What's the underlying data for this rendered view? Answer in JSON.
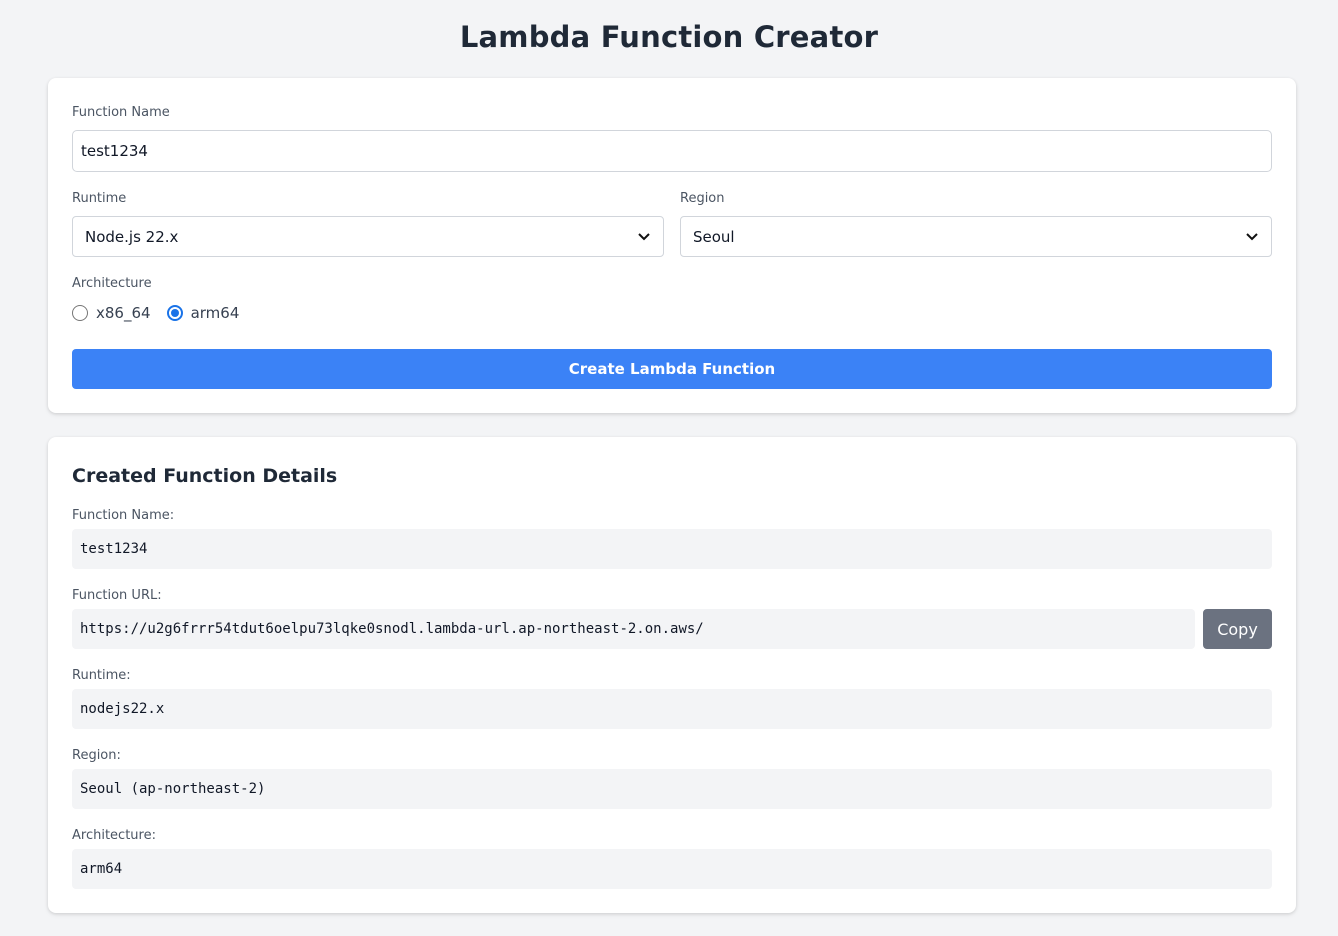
{
  "header": {
    "title": "Lambda Function Creator"
  },
  "form": {
    "function_name_label": "Function Name",
    "function_name_value": "test1234",
    "runtime_label": "Runtime",
    "runtime_selected": "Node.js 22.x",
    "region_label": "Region",
    "region_selected": "Seoul",
    "architecture_label": "Architecture",
    "architecture_options": [
      {
        "label": "x86_64",
        "checked": false
      },
      {
        "label": "arm64",
        "checked": true
      }
    ],
    "submit_label": "Create Lambda Function"
  },
  "details": {
    "title": "Created Function Details",
    "function_name_label": "Function Name:",
    "function_name_value": "test1234",
    "function_url_label": "Function URL:",
    "function_url_value": "https://u2g6frrr54tdut6oelpu73lqke0snodl.lambda-url.ap-northeast-2.on.aws/",
    "copy_label": "Copy",
    "runtime_label": "Runtime:",
    "runtime_value": "nodejs22.x",
    "region_label": "Region:",
    "region_value": "Seoul (ap-northeast-2)",
    "architecture_label": "Architecture:",
    "architecture_value": "arm64"
  },
  "colors": {
    "accent": "#3b82f6",
    "radio_checked": "#1a73e8",
    "copy_button": "#6b7280",
    "background": "#f3f4f6"
  },
  "icons": {
    "select_arrow": "chevron-down-icon"
  }
}
